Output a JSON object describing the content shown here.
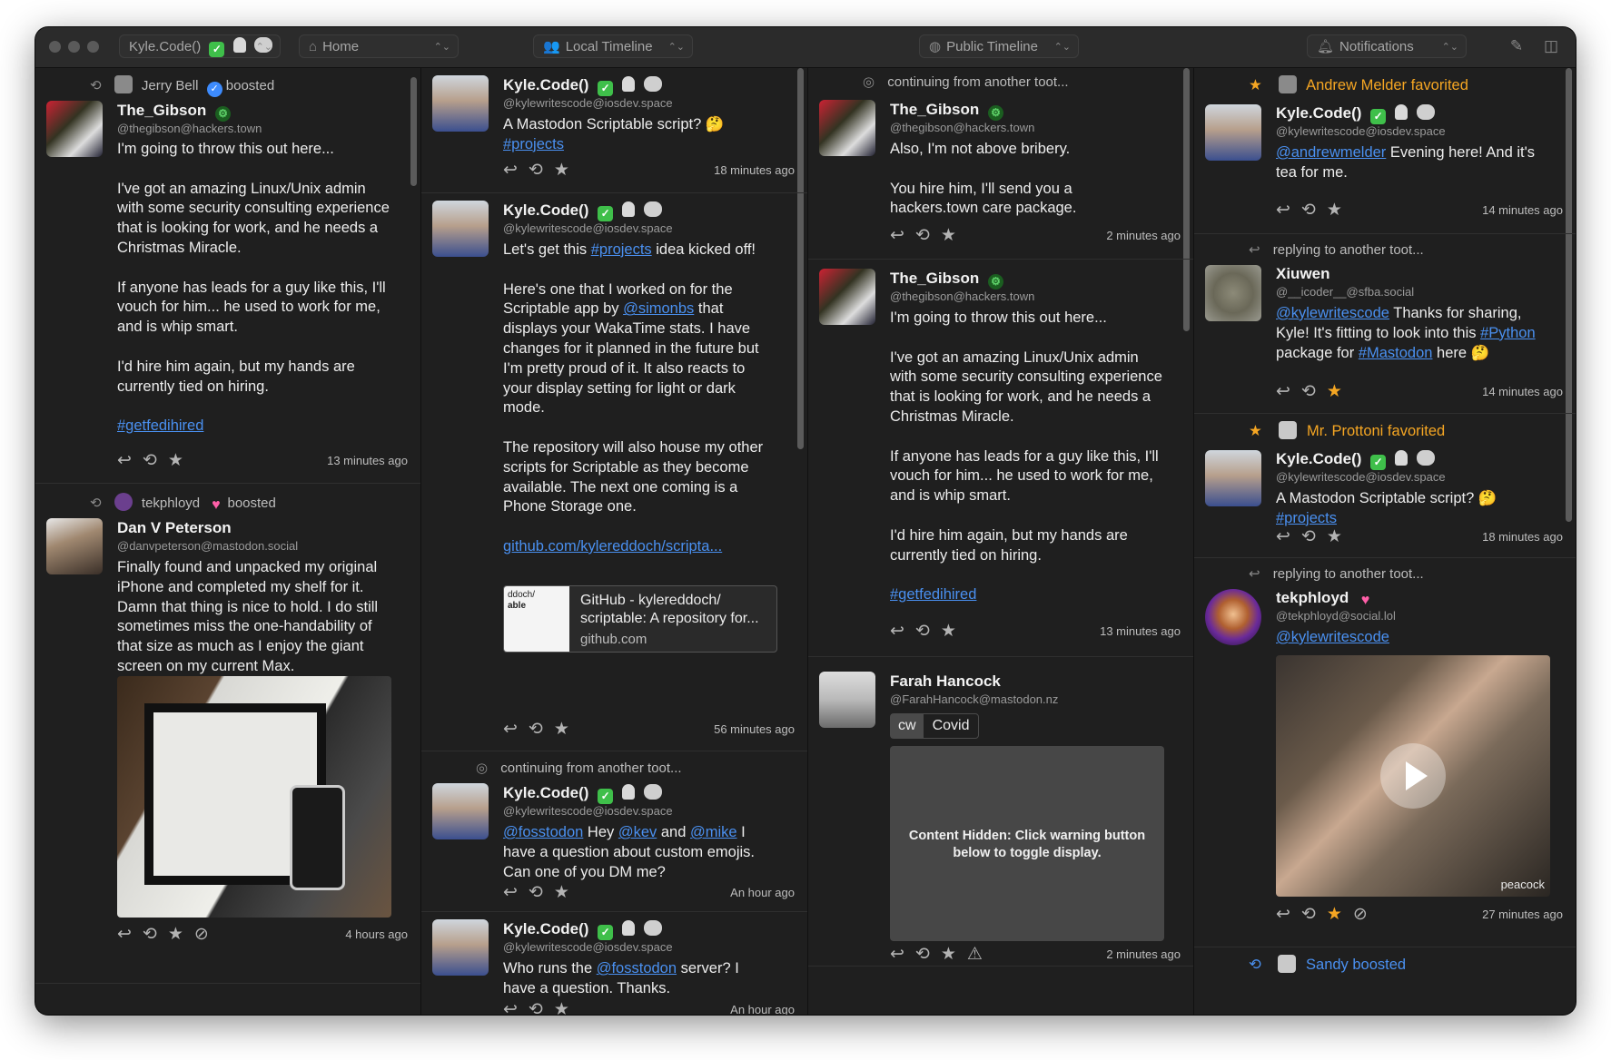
{
  "toolbar": {
    "account_label": "Kyle.Code()",
    "home_label": "Home",
    "local_label": "Local Timeline",
    "public_label": "Public Timeline",
    "notifications_label": "Notifications"
  },
  "col1": {
    "post1": {
      "boost_by": "Jerry Bell",
      "boost_action": "boosted",
      "name": "The_Gibson",
      "handle": "@thegibson@hackers.town",
      "p1": "I'm going to throw this out here...",
      "p2": "I've got an amazing Linux/Unix admin with some security consulting experience that is looking for work, and he needs a Christmas Miracle.",
      "p3": "If anyone has leads for a guy like this, I'll vouch for him... he used to work for me, and is whip smart.",
      "p4": "I'd hire him again, but my hands are currently tied on hiring.",
      "tag": "#getfedihired",
      "time": "13 minutes ago"
    },
    "post2": {
      "boost_by": "tekphloyd",
      "boost_action": "boosted",
      "name": "Dan V Peterson",
      "handle": "@danvpeterson@mastodon.social",
      "text": "Finally found and unpacked my original iPhone and completed my shelf for it. Damn that thing is nice to hold. I do still sometimes miss the one-handability of that size as much as I enjoy the giant screen on my current Max.",
      "time": "4 hours ago"
    }
  },
  "col2": {
    "post1": {
      "name": "Kyle.Code()",
      "handle": "@kylewritescode@iosdev.space",
      "text": "A Mastodon Scriptable script? 🤔",
      "tag": "#projects",
      "time": "18 minutes ago"
    },
    "post2": {
      "name": "Kyle.Code()",
      "handle": "@kylewritescode@iosdev.space",
      "p1_a": "Let's get this ",
      "p1_tag": "#projects",
      "p1_b": " idea kicked off!",
      "p2_a": "Here's one that I worked on for the Scriptable app by ",
      "p2_mention": "@simonbs",
      "p2_b": " that displays your WakaTime stats. I have changes for it planned in the future but I'm pretty proud of it. It also reacts to your display setting for light or dark mode.",
      "p3": "The repository will also house my other scripts for Scriptable as they become available. The next one coming is a Phone Storage one.",
      "link": "github.com/kylereddoch/scripta...",
      "card_title": "GitHub - kylereddoch/ scriptable: A repository for...",
      "card_domain": "github.com",
      "card_thumb_l1": "ddoch/",
      "card_thumb_l2": "able",
      "time": "56 minutes ago"
    },
    "post3": {
      "context": "continuing from another toot...",
      "name": "Kyle.Code()",
      "handle": "@kylewritescode@iosdev.space",
      "m1": "@fosstodon",
      "t1": " Hey ",
      "m2": "@kev",
      "t2": " and ",
      "m3": "@mike",
      "t3": " I have a question about custom emojis. Can one of you DM me?",
      "time": "An hour ago"
    },
    "post4": {
      "name": "Kyle.Code()",
      "handle": "@kylewritescode@iosdev.space",
      "t1": "Who runs the ",
      "m1": "@fosstodon",
      "t2": " server? I have a question. Thanks.",
      "time": "An hour ago"
    }
  },
  "col3": {
    "post1": {
      "context": "continuing from another toot...",
      "name": "The_Gibson",
      "handle": "@thegibson@hackers.town",
      "p1": "Also, I'm not above bribery.",
      "p2": "You hire him, I'll send you a hackers.town care package.",
      "time": "2 minutes ago"
    },
    "post2": {
      "name": "The_Gibson",
      "handle": "@thegibson@hackers.town",
      "p1": "I'm going to throw this out here...",
      "p2": "I've got an amazing Linux/Unix admin with some security consulting experience that is looking for work, and he needs a Christmas Miracle.",
      "p3": "If anyone has leads for a guy like this, I'll vouch for him... he used to work for me, and is whip smart.",
      "p4": "I'd hire him again, but my hands are currently tied on hiring.",
      "tag": "#getfedihired",
      "time": "13 minutes ago"
    },
    "post3": {
      "name": "Farah Hancock",
      "handle": "@FarahHancock@mastodon.nz",
      "cw_tag": "cw",
      "cw_text": "Covid",
      "hidden": "Content Hidden: Click warning button below to toggle display.",
      "time": "2 minutes ago"
    }
  },
  "col4": {
    "n1": {
      "actor": "Andrew Melder favorited",
      "name": "Kyle.Code()",
      "handle": "@kylewritescode@iosdev.space",
      "mention": "@andrewmelder",
      "text": " Evening here! And it's tea for me.",
      "time": "14 minutes ago"
    },
    "n2": {
      "context": "replying to another toot...",
      "name": "Xiuwen",
      "handle": "@__icoder__@sfba.social",
      "mention": "@kylewritescode",
      "t1": " Thanks for sharing, Kyle! It's fitting to look into this ",
      "tag1": "#Python",
      "t2": " package for ",
      "tag2": "#Mastodon",
      "t3": " here 🤔",
      "time": "14 minutes ago"
    },
    "n3": {
      "actor": "Mr. Prottoni favorited",
      "name": "Kyle.Code()",
      "handle": "@kylewritescode@iosdev.space",
      "text": "A Mastodon Scriptable script? 🤔",
      "tag": "#projects",
      "time": "18 minutes ago"
    },
    "n4": {
      "context": "replying to another toot...",
      "name": "tekphloyd",
      "handle": "@tekphloyd@social.lol",
      "mention": "@kylewritescode",
      "video_brand": "peacock",
      "time": "27 minutes ago"
    },
    "n5": {
      "actor": "Sandy boosted"
    }
  },
  "colors": {
    "background": "#1f1f1f",
    "link": "#4a90f0",
    "favorite": "#f5a623",
    "boost_blue": "#4a90f0"
  }
}
